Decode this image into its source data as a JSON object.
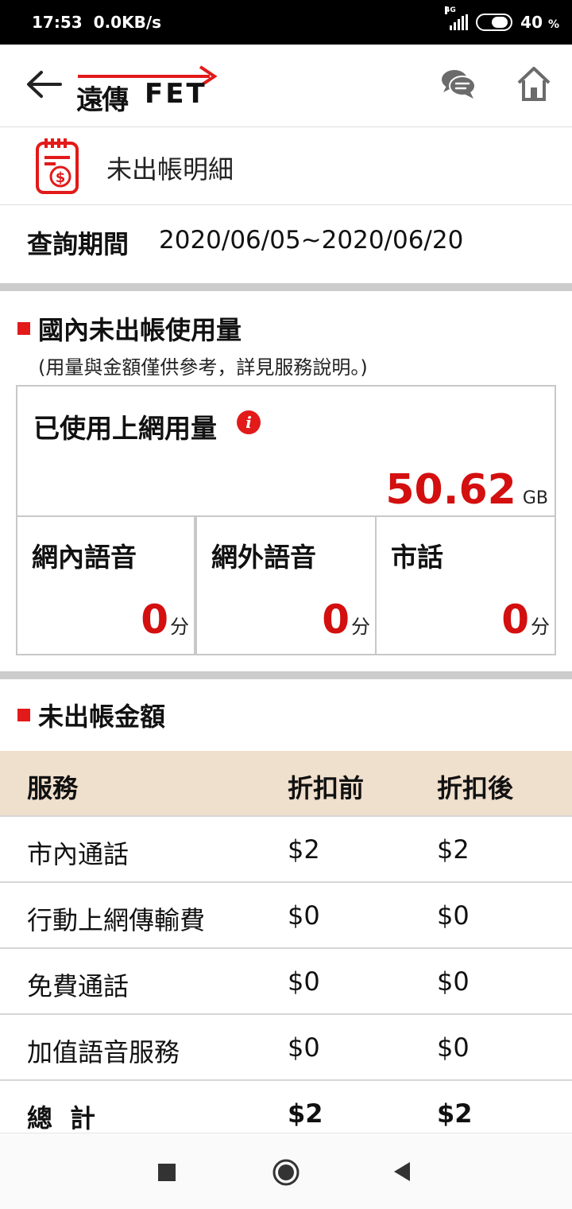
{
  "status_bar": {
    "time": "17:53",
    "net_speed": "0.0KB/s",
    "network_type": "4G",
    "battery": "40",
    "battery_unit": "%"
  },
  "header": {
    "logo_cn": "遠傳",
    "logo_en": "FET",
    "icons": [
      "back-arrow-icon",
      "chat-icon",
      "home-icon"
    ]
  },
  "page": {
    "title": "未出帳明細"
  },
  "period": {
    "label": "查詢期間",
    "value": "2020/06/05~2020/06/20"
  },
  "usage": {
    "heading": "國內未出帳使用量",
    "note": "(用量與金額僅供參考，詳見服務說明。)",
    "data": {
      "label": "已使用上網用量",
      "value": "50.62",
      "unit": "GB"
    },
    "voice": [
      {
        "label": "網內語音",
        "value": "0",
        "unit": "分"
      },
      {
        "label": "網外語音",
        "value": "0",
        "unit": "分"
      },
      {
        "label": "市話",
        "value": "0",
        "unit": "分"
      }
    ]
  },
  "amount": {
    "heading": "未出帳金額",
    "columns": [
      "服務",
      "折扣前",
      "折扣後"
    ],
    "rows": [
      {
        "service": "市內通話",
        "before": "$2",
        "after": "$2"
      },
      {
        "service": "行動上網傳輸費",
        "before": "$0",
        "after": "$0"
      },
      {
        "service": "免費通話",
        "before": "$0",
        "after": "$0"
      },
      {
        "service": "加值語音服務",
        "before": "$0",
        "after": "$0"
      }
    ],
    "total": {
      "label": "總計",
      "before": "$2",
      "after": "$2"
    }
  },
  "colors": {
    "accent_red": "#e21a1a",
    "table_header_bg": "#efdfcd"
  }
}
